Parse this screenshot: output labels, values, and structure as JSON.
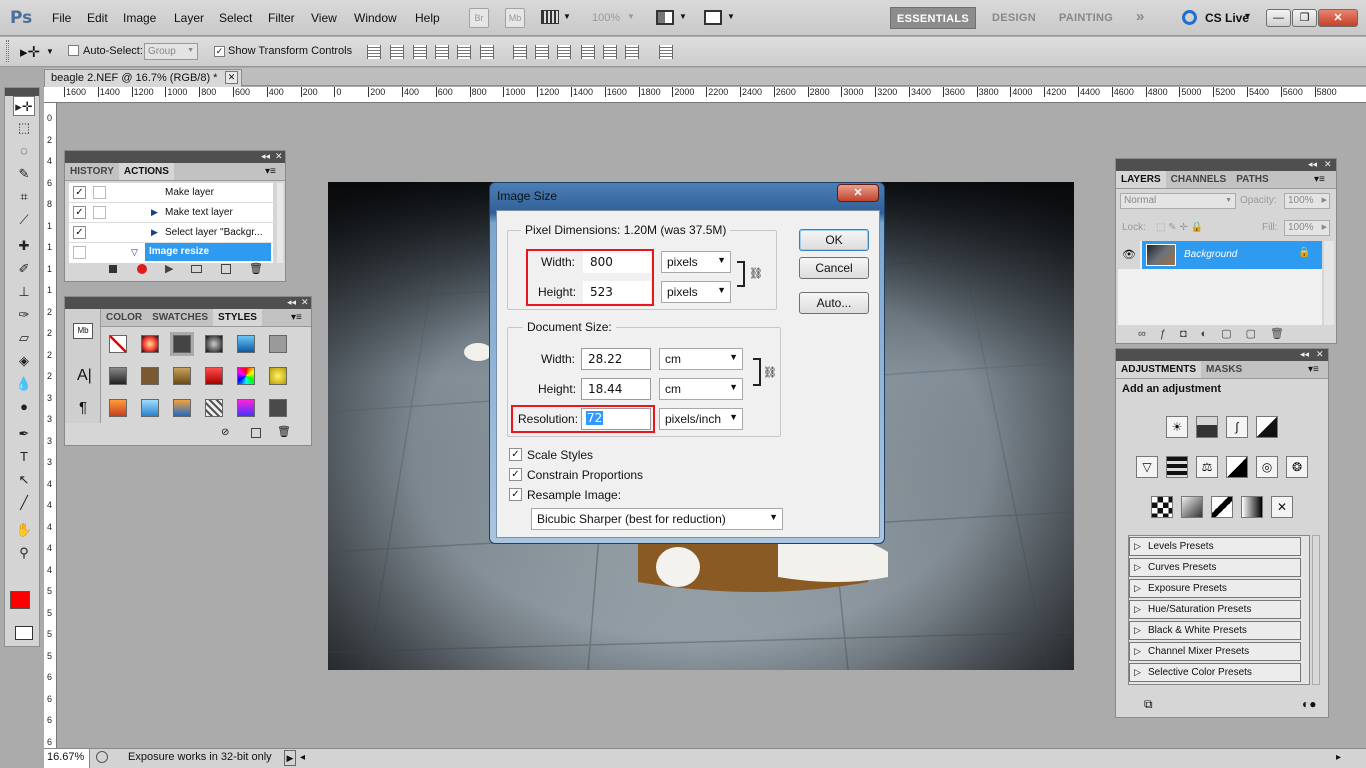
{
  "app": {
    "logo": "Ps"
  },
  "menu": [
    "File",
    "Edit",
    "Image",
    "Layer",
    "Select",
    "Filter",
    "View",
    "Window",
    "Help"
  ],
  "menubar": {
    "bridge": "Br",
    "minibridge": "Mb",
    "zoom": "100%",
    "cslive": "CS Live",
    "cslive_arrow": "▾"
  },
  "workspaces": [
    "ESSENTIALS",
    "DESIGN",
    "PAINTING"
  ],
  "workspaces_more": "»",
  "window_controls": {
    "min": "—",
    "max": "❐",
    "close": "✕"
  },
  "options": {
    "auto_select_label": "Auto-Select:",
    "auto_select_value": "Group",
    "show_transform_label": "Show Transform Controls"
  },
  "doc_tab": {
    "title": "beagle 2.NEF @ 16.7% (RGB/8) *",
    "close": "✕"
  },
  "ruler_labels": [
    "1600",
    "1400",
    "1200",
    "1000",
    "800",
    "600",
    "400",
    "200",
    "0",
    "200",
    "400",
    "600",
    "800",
    "1000",
    "1200",
    "1400",
    "1600",
    "1800",
    "2000",
    "2200",
    "2400",
    "2600",
    "2800",
    "3000",
    "3200",
    "3400",
    "3600",
    "3800",
    "4000",
    "4200",
    "4400",
    "4600",
    "4800",
    "5000",
    "5200",
    "5400",
    "5600",
    "5800"
  ],
  "vruler_labels": [
    "0",
    "2",
    "4",
    "6",
    "8",
    "1",
    "1",
    "1",
    "1",
    "2",
    "2",
    "2",
    "2",
    "3",
    "3",
    "3",
    "3",
    "4",
    "4",
    "4",
    "4",
    "4",
    "5",
    "5",
    "5",
    "5",
    "6",
    "6",
    "6",
    "6"
  ],
  "history_panel": {
    "tabs": [
      "HISTORY",
      "ACTIONS"
    ],
    "items": [
      "Make layer",
      "Make text layer",
      "Select layer \"Backgr...",
      "Image resize"
    ]
  },
  "styles_panel": {
    "tabs": [
      "COLOR",
      "SWATCHES",
      "STYLES"
    ]
  },
  "dialog": {
    "title": "Image Size",
    "close": "✕",
    "pixel_dimensions_label": "Pixel Dimensions:  1.20M (was 37.5M)",
    "width_label": "Width:",
    "width_value": "800",
    "height_label": "Height:",
    "height_value": "523",
    "pixel_unit": "pixels",
    "document_size_label": "Document Size:",
    "doc_width_label": "Width:",
    "doc_width_value": "28.22",
    "doc_height_label": "Height:",
    "doc_height_value": "18.44",
    "doc_unit": "cm",
    "resolution_label": "Resolution:",
    "resolution_value": "72",
    "resolution_unit": "pixels/inch",
    "scale_styles": "Scale Styles",
    "constrain": "Constrain Proportions",
    "resample": "Resample Image:",
    "resample_method": "Bicubic Sharper (best for reduction)",
    "ok": "OK",
    "cancel": "Cancel",
    "auto": "Auto..."
  },
  "layers_panel": {
    "tabs": [
      "LAYERS",
      "CHANNELS",
      "PATHS"
    ],
    "blend_mode": "Normal",
    "opacity_label": "Opacity:",
    "opacity_value": "100%",
    "lock_label": "Lock:",
    "fill_label": "Fill:",
    "fill_value": "100%",
    "layer_name": "Background"
  },
  "adjustments_panel": {
    "tabs": [
      "ADJUSTMENTS",
      "MASKS"
    ],
    "heading": "Add an adjustment",
    "presets": [
      "Levels Presets",
      "Curves Presets",
      "Exposure Presets",
      "Hue/Saturation Presets",
      "Black & White Presets",
      "Channel Mixer Presets",
      "Selective Color Presets"
    ]
  },
  "status": {
    "zoom": "16.67%",
    "message": "Exposure works in 32-bit only"
  },
  "colors": {
    "foreground": "#ff0000",
    "background": "#ffffff",
    "layer_selected": "#2e9bf0",
    "red_highlight": "#e8151b"
  }
}
